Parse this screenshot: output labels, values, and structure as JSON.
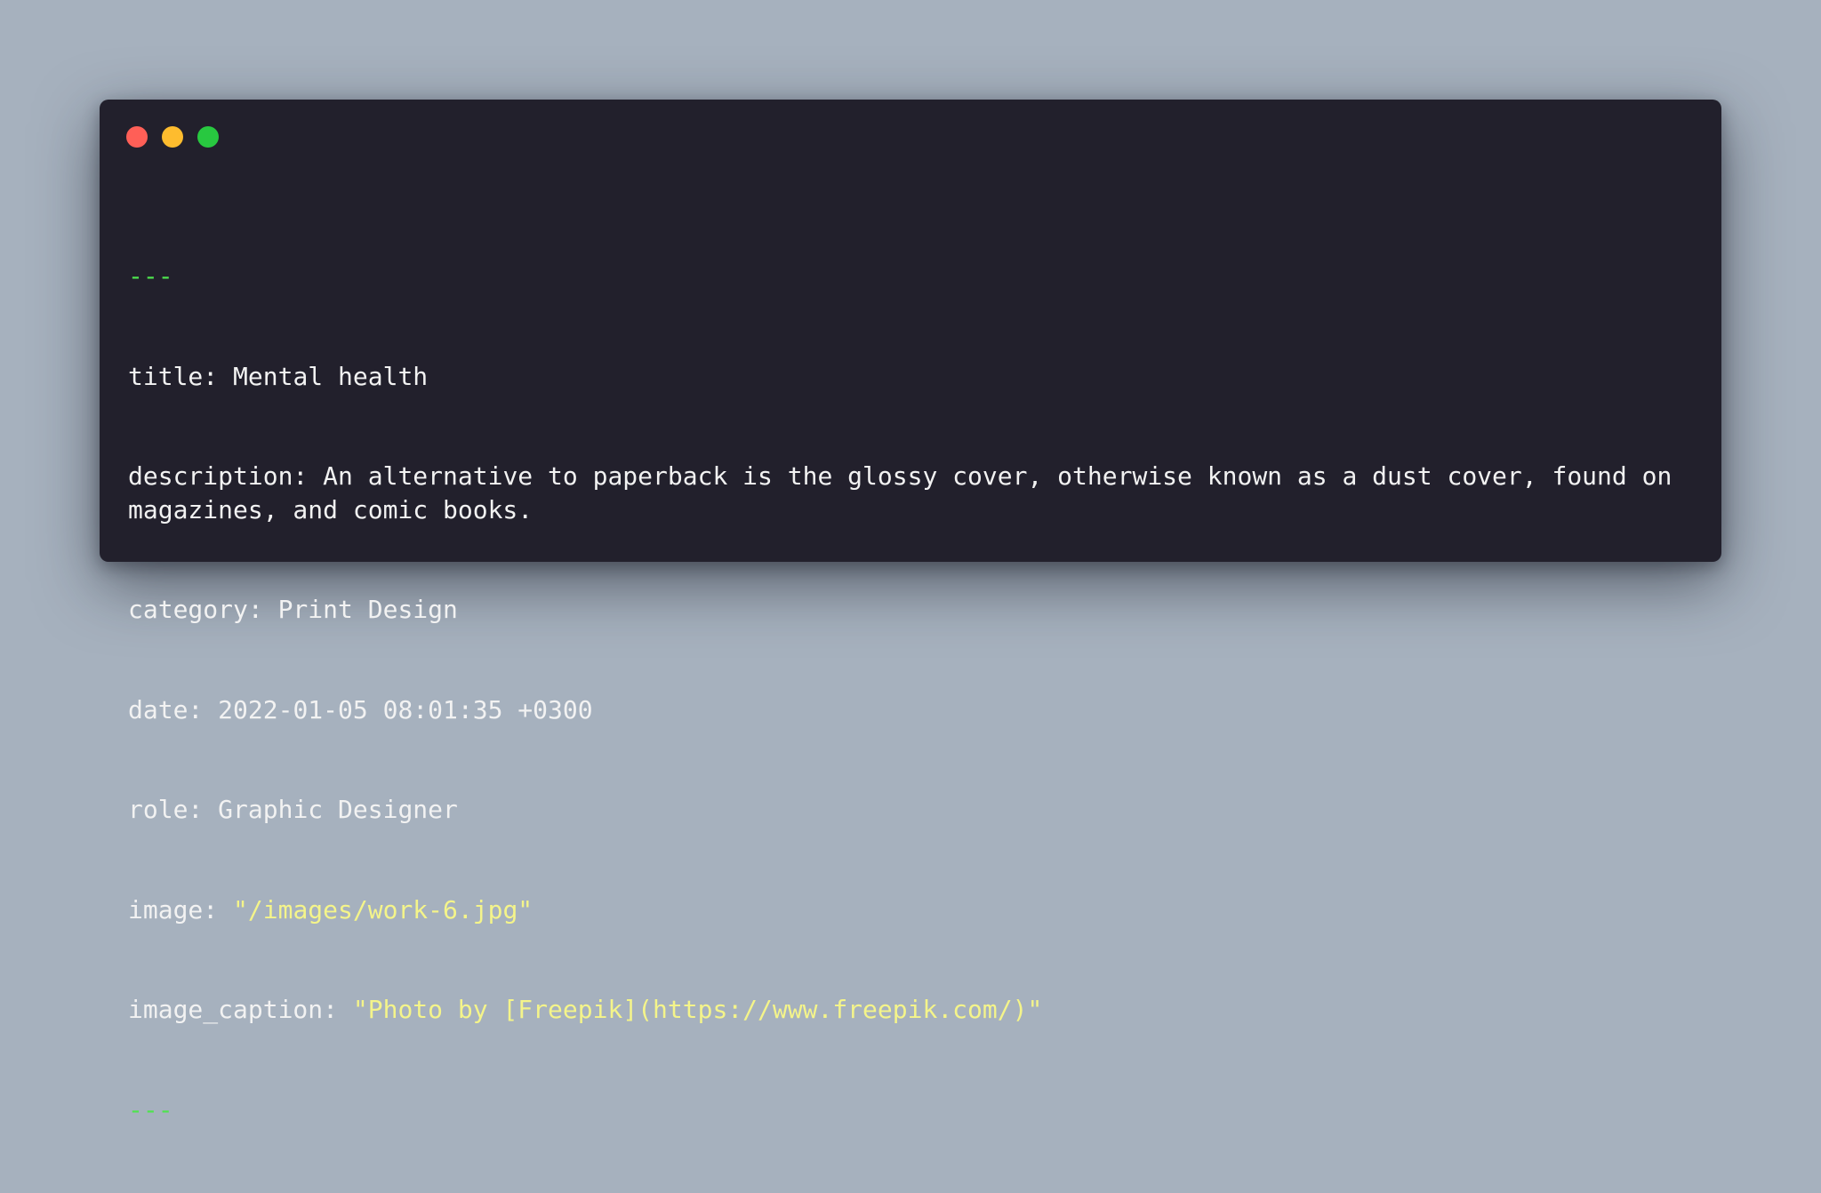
{
  "window": {
    "controls": [
      {
        "name": "close",
        "color": "#ff5f57"
      },
      {
        "name": "minimize",
        "color": "#febc2e"
      },
      {
        "name": "maximize",
        "color": "#28c840"
      }
    ]
  },
  "frontmatter": {
    "open_delim": "---",
    "title_key": "title: ",
    "title_value": "Mental health",
    "description_key": "description: ",
    "description_value": "An alternative to paperback is the glossy cover, otherwise known as a dust cover, found on magazines, and comic books.",
    "category_key": "category: ",
    "category_value": "Print Design",
    "date_key": "date: ",
    "date_value": "2022-01-05 08:01:35 +0300",
    "role_key": "role: ",
    "role_value": "Graphic Designer",
    "image_key": "image: ",
    "image_value": "\"/images/work-6.jpg\"",
    "image_caption_key": "image_caption: ",
    "image_caption_value": "\"Photo by [Freepik](https://www.freepik.com/)\"",
    "close_delim": "---"
  }
}
